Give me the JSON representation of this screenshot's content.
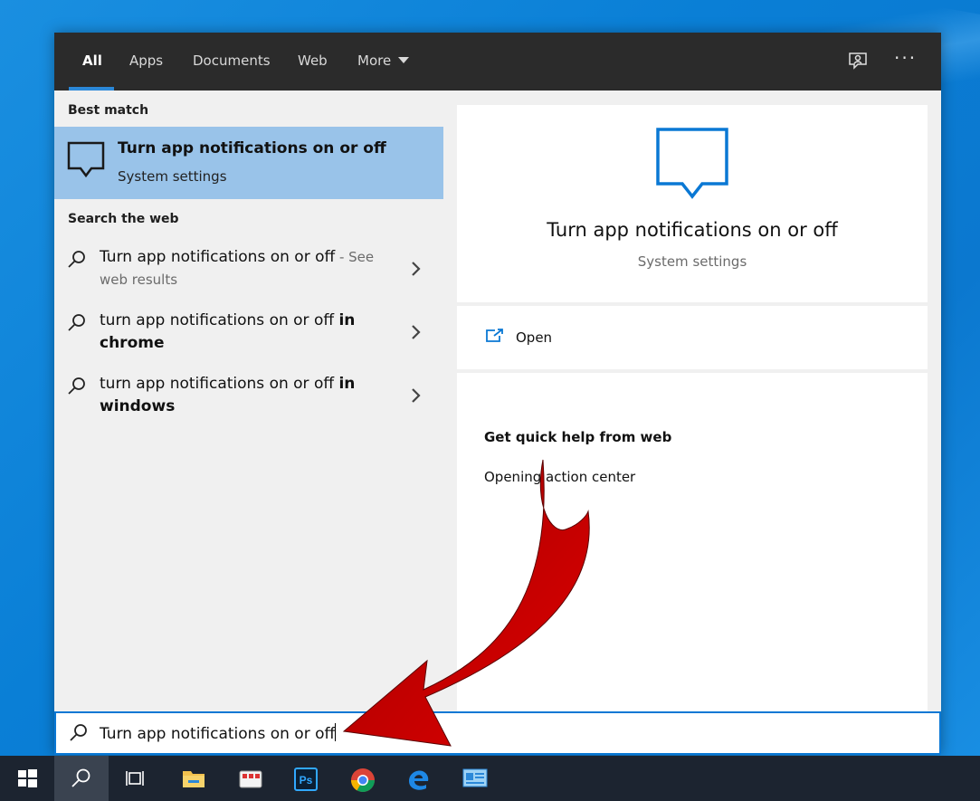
{
  "tabs": [
    {
      "label": "All",
      "active": true
    },
    {
      "label": "Apps"
    },
    {
      "label": "Documents"
    },
    {
      "label": "Web"
    },
    {
      "label": "More"
    }
  ],
  "toolbar": {
    "feedback_icon": "feedback-icon",
    "more_options": "···"
  },
  "left": {
    "best_match_header": "Best match",
    "best_match": {
      "title": "Turn app notifications on or off",
      "subtitle": "System settings",
      "icon": "notification-message-icon"
    },
    "search_web_header": "Search the web",
    "web_results": [
      {
        "query": "Turn app notifications on or off",
        "suffix": " - See",
        "suffix2": "web results"
      },
      {
        "query": "turn app notifications on or off ",
        "bold": "in",
        "bold2": "chrome"
      },
      {
        "query": "turn app notifications on or off ",
        "bold": "in",
        "bold2": "windows"
      }
    ]
  },
  "right": {
    "title": "Turn app notifications on or off",
    "subtitle": "System settings",
    "open_label": "Open",
    "help_header": "Get quick help from web",
    "help_link": "Opening action center"
  },
  "search": {
    "query": "Turn app notifications on or off"
  },
  "taskbar": {
    "items": [
      "windows-start-icon",
      "search-icon",
      "task-view-icon",
      "file-explorer-icon",
      "app-icon",
      "photoshop-icon",
      "chrome-icon",
      "edge-icon",
      "control-panel-icon"
    ],
    "photoshop_label": "Ps"
  },
  "colors": {
    "accent": "#0a78d4",
    "selection": "#99c3e9",
    "topbar": "#2b2b2b",
    "arrow": "#c00000"
  }
}
